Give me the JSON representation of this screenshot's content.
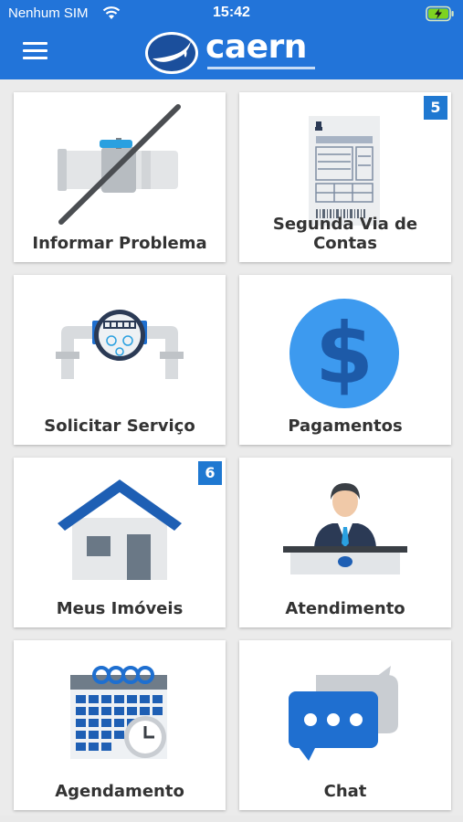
{
  "status_bar": {
    "carrier": "Nenhum SIM",
    "time": "15:42"
  },
  "header": {
    "logo_text": "caern",
    "menu_icon": "hamburger-menu-icon"
  },
  "tiles": [
    {
      "label": "Informar Problema",
      "icon": "pipe-crossed-icon"
    },
    {
      "label": "Segunda Via de Contas",
      "icon": "bill-document-icon",
      "badge": "5"
    },
    {
      "label": "Solicitar Serviço",
      "icon": "water-meter-icon"
    },
    {
      "label": "Pagamentos",
      "icon": "dollar-coin-icon"
    },
    {
      "label": "Meus Imóveis",
      "icon": "house-icon",
      "badge": "6"
    },
    {
      "label": "Atendimento",
      "icon": "attendant-desk-icon"
    },
    {
      "label": "Agendamento",
      "icon": "calendar-clock-icon"
    },
    {
      "label": "Chat",
      "icon": "chat-bubbles-icon"
    }
  ],
  "colors": {
    "header_bg": "#2274d9",
    "badge_bg": "#1f78d1",
    "icon_blue": "#1e5fb4",
    "coin_blue": "#3d9aef"
  }
}
